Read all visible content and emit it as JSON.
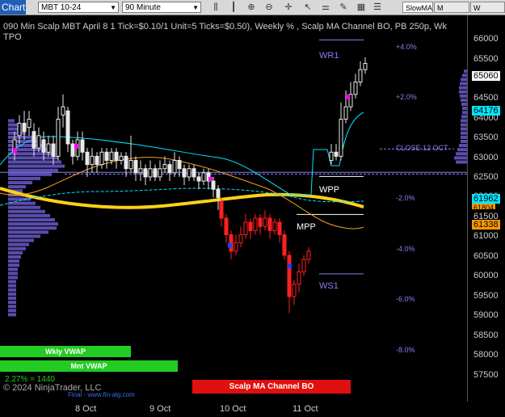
{
  "toolbar": {
    "chart_label": "Chart",
    "instrument": "MBT 10-24",
    "interval": "90 Minute",
    "indicator": "SlowMA",
    "buttons": [
      "M VWAP",
      "W VWAP"
    ]
  },
  "chart": {
    "title": "090 Min Scalp MBT April 8 1 Tick=$0.10/1 Unit=5 Ticks=$0.50), Weekly % , Scalp MA Channel BO, PB 250p, Wk TPO",
    "price_ticks": [
      "66000",
      "65500",
      "65000",
      "64500",
      "64000",
      "63500",
      "63000",
      "62500",
      "62000",
      "61500",
      "61000",
      "60500",
      "60000",
      "59500",
      "59000",
      "58500",
      "58000",
      "57500"
    ],
    "price_labels": [
      {
        "text": "65060",
        "color": "#ffffff"
      },
      {
        "text": "64176",
        "color": "#00ffff"
      },
      {
        "text": "61962",
        "color": "#00ffff"
      },
      {
        "text": "61804",
        "color": "#ff9900"
      },
      {
        "text": "61338",
        "color": "#ff9900"
      }
    ],
    "pct_labels": [
      "+4.0%",
      "+2.0%",
      "-2.0%",
      "-4.0%",
      "-6.0%",
      "-8.0%"
    ],
    "levels": [
      "WR1",
      "WPP",
      "MPP",
      "WS1"
    ],
    "close_label": "CLOSE 12 OCT",
    "x_ticks": [
      "8 Oct",
      "9 Oct",
      "10 Oct",
      "11 Oct"
    ],
    "wkly_vwap": "Wkly VWAP",
    "mnt_vwap": "Mnt VWAP",
    "scalp_label": "Scalp MA Channel BO",
    "pct_line": "2.27% = 1440",
    "copyright": "© 2024 NinjaTrader, LLC",
    "final_text": "Final - www.fin-alg.com",
    "colors": {
      "up": "#e8e8e8",
      "down": "#ff2020",
      "profile": "#6a5acd",
      "cyan": "#00e5ff",
      "orange": "#f0a020",
      "yellow": "#ffd11a",
      "green": "#22cc22",
      "red_bar": "#e01010"
    }
  }
}
